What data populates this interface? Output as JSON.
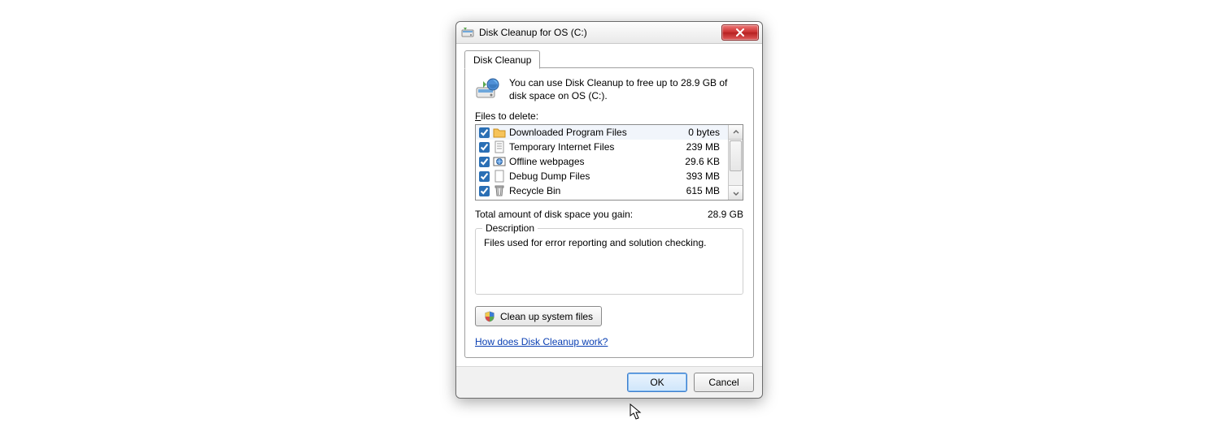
{
  "window": {
    "title": "Disk Cleanup for OS (C:)"
  },
  "tab": {
    "label": "Disk Cleanup"
  },
  "info": "You can use Disk Cleanup to free up to 28.9 GB of disk space on OS (C:).",
  "files_label_prefix": "F",
  "files_label_rest": "iles to delete:",
  "items": [
    {
      "name": "Downloaded Program Files",
      "size": "0 bytes",
      "checked": true
    },
    {
      "name": "Temporary Internet Files",
      "size": "239 MB",
      "checked": true
    },
    {
      "name": "Offline webpages",
      "size": "29.6 KB",
      "checked": true
    },
    {
      "name": "Debug Dump Files",
      "size": "393 MB",
      "checked": true
    },
    {
      "name": "Recycle Bin",
      "size": "615 MB",
      "checked": true
    }
  ],
  "total": {
    "label": "Total amount of disk space you gain:",
    "value": "28.9 GB"
  },
  "description": {
    "label": "Description",
    "text": "Files used for error reporting and solution checking."
  },
  "cleanup_button": "Clean up system files",
  "help_link": "How does Disk Cleanup work?",
  "buttons": {
    "ok": "OK",
    "cancel": "Cancel"
  }
}
